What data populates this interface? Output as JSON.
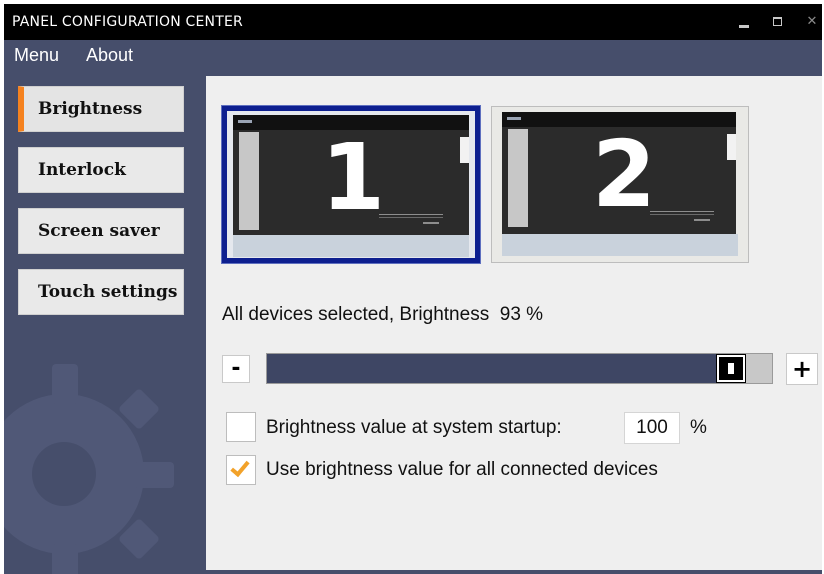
{
  "window": {
    "title": "PANEL CONFIGURATION CENTER",
    "controls": {
      "minimize": "minimize-icon",
      "maximize": "maximize-icon",
      "close": "close-icon",
      "close_glyph": "✕"
    }
  },
  "menubar": {
    "items": [
      {
        "label": "Menu"
      },
      {
        "label": "About"
      }
    ]
  },
  "sidebar": {
    "items": [
      {
        "label": "Brightness",
        "active": true
      },
      {
        "label": "Interlock",
        "active": false
      },
      {
        "label": "Screen saver",
        "active": false
      },
      {
        "label": "Touch settings",
        "active": false
      }
    ]
  },
  "devices": [
    {
      "number": "1",
      "selected": true
    },
    {
      "number": "2",
      "selected": false
    }
  ],
  "brightness": {
    "status_prefix": "All devices selected, Brightness",
    "value": 93,
    "value_text": "93 %",
    "minus_label": "-",
    "plus_label": "+"
  },
  "startup": {
    "label": "Brightness value at system startup:",
    "value": "100",
    "unit": "%",
    "checked": false
  },
  "apply_all": {
    "label": "Use brightness value for all connected devices",
    "checked": true
  },
  "colors": {
    "accent": "#f5821f",
    "sidebar_bg": "#464e6b",
    "slider_fill": "#3e4664",
    "check": "#f2a22a",
    "selected_border": "#0d1f8f"
  }
}
